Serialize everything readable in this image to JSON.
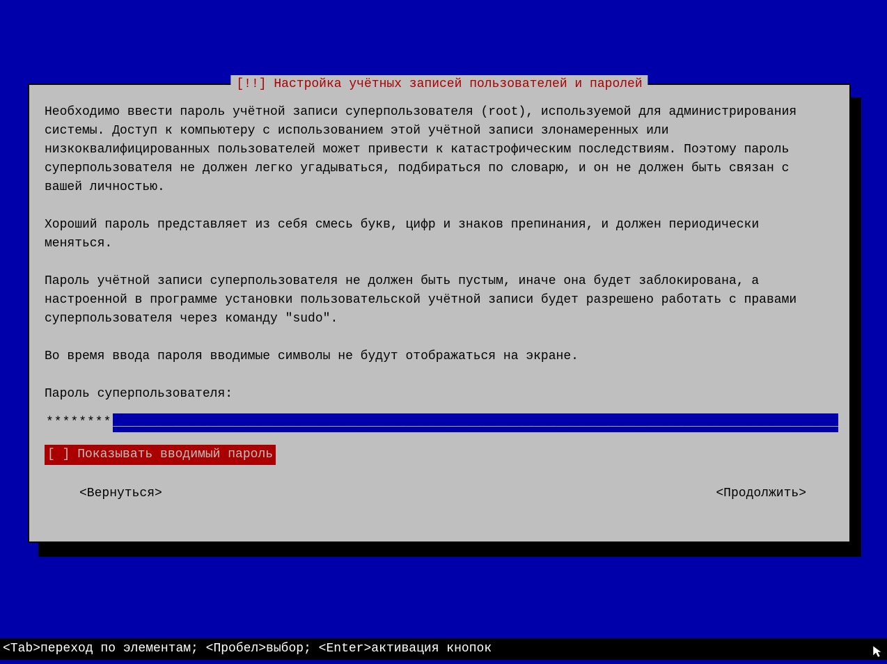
{
  "dialog": {
    "title": "[!!] Настройка учётных записей пользователей и паролей",
    "paragraph1": "Необходимо ввести пароль учётной записи суперпользователя (root), используемой для администрирования системы. Доступ к компьютеру с использованием этой учётной записи злонамеренных или низкоквалифицированных пользователей может привести к катастрофическим последствиям. Поэтому пароль суперпользователя не должен легко угадываться, подбираться по словарю, и он не должен быть связан с вашей личностью.",
    "paragraph2": "Хороший пароль представляет из себя смесь букв, цифр и знаков препинания, и должен периодически меняться.",
    "paragraph3": "Пароль учётной записи суперпользователя не должен быть пустым, иначе она будет заблокирована, а настроенной в программе установки пользовательской учётной записи будет разрешено работать с правами суперпользователя через команду \"sudo\".",
    "paragraph4": "Во время ввода пароля вводимые символы не будут отображаться на экране.",
    "password_label": "Пароль суперпользователя:",
    "password_value": "********",
    "password_underline": "________________________________________________________________________________________________________________________________________________________",
    "checkbox_label": "[ ] Показывать вводимый пароль",
    "back_button": "<Вернуться>",
    "continue_button": "<Продолжить>"
  },
  "footer": {
    "text": "<Tab>переход по элементам; <Пробел>выбор; <Enter>активация кнопок"
  }
}
